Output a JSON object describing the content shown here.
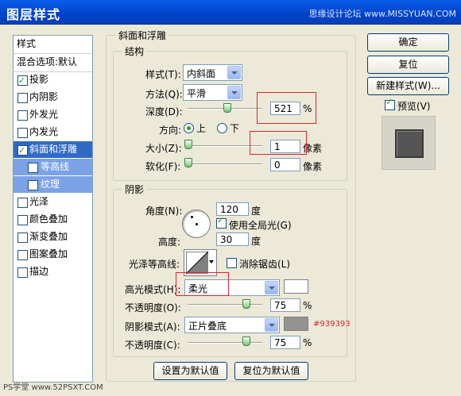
{
  "window": {
    "title": "图层样式",
    "watermark_top": "思缘设计论坛 www.MISSYUAN.COM"
  },
  "sidebar": {
    "items": [
      {
        "label": "样式",
        "checkbox": false
      },
      {
        "label": "混合选项:默认",
        "checkbox": false
      },
      {
        "label": "投影",
        "checkbox": true,
        "checked": true
      },
      {
        "label": "内阴影",
        "checkbox": true,
        "checked": false
      },
      {
        "label": "外发光",
        "checkbox": true,
        "checked": false
      },
      {
        "label": "内发光",
        "checkbox": true,
        "checked": false
      },
      {
        "label": "斜面和浮雕",
        "checkbox": true,
        "checked": true,
        "selected": true
      },
      {
        "label": "等高线",
        "checkbox": true,
        "checked": false,
        "sub": true
      },
      {
        "label": "纹理",
        "checkbox": true,
        "checked": false,
        "sub": true
      },
      {
        "label": "光泽",
        "checkbox": true,
        "checked": false
      },
      {
        "label": "颜色叠加",
        "checkbox": true,
        "checked": false
      },
      {
        "label": "渐变叠加",
        "checkbox": true,
        "checked": false
      },
      {
        "label": "图案叠加",
        "checkbox": true,
        "checked": false
      },
      {
        "label": "描边",
        "checkbox": true,
        "checked": false
      }
    ]
  },
  "bevel": {
    "group_title": "斜面和浮雕",
    "structure_title": "结构",
    "style_label": "样式(T):",
    "style_value": "内斜面",
    "method_label": "方法(Q):",
    "method_value": "平滑",
    "depth_label": "深度(D):",
    "depth_value": "521",
    "depth_unit": "%",
    "depth_fraction": 0.52,
    "direction_label": "方向:",
    "direction_up": "上",
    "direction_down": "下",
    "size_label": "大小(Z):",
    "size_value": "1",
    "size_unit": "像素",
    "soften_label": "软化(F):",
    "soften_value": "0",
    "soften_unit": "像素"
  },
  "shading": {
    "title": "阴影",
    "angle_label": "角度(N):",
    "angle_value": "120",
    "angle_unit": "度",
    "global_light_label": "使用全局光(G)",
    "altitude_label": "高度:",
    "altitude_value": "30",
    "altitude_unit": "度",
    "gloss_label": "光泽等高线:",
    "antialias_label": "消除锯齿(L)",
    "highlight_mode_label": "高光模式(H):",
    "highlight_mode_value": "柔光",
    "highlight_color": "#ffffff",
    "highlight_opacity_label": "不透明度(O):",
    "highlight_opacity_value": "75",
    "shadow_mode_label": "阴影模式(A):",
    "shadow_mode_value": "正片叠底",
    "shadow_color": "#939393",
    "shadow_color_text": "#939393",
    "shadow_opacity_label": "不透明度(C):",
    "shadow_opacity_value": "75",
    "opacity_unit": "%"
  },
  "footer": {
    "make_default": "设置为默认值",
    "reset_default": "复位为默认值"
  },
  "right": {
    "ok": "确定",
    "reset": "复位",
    "new_style": "新建样式(W)...",
    "preview": "预览(V)"
  },
  "watermark_bottom": "PS学堂 www.52PSXT.COM"
}
